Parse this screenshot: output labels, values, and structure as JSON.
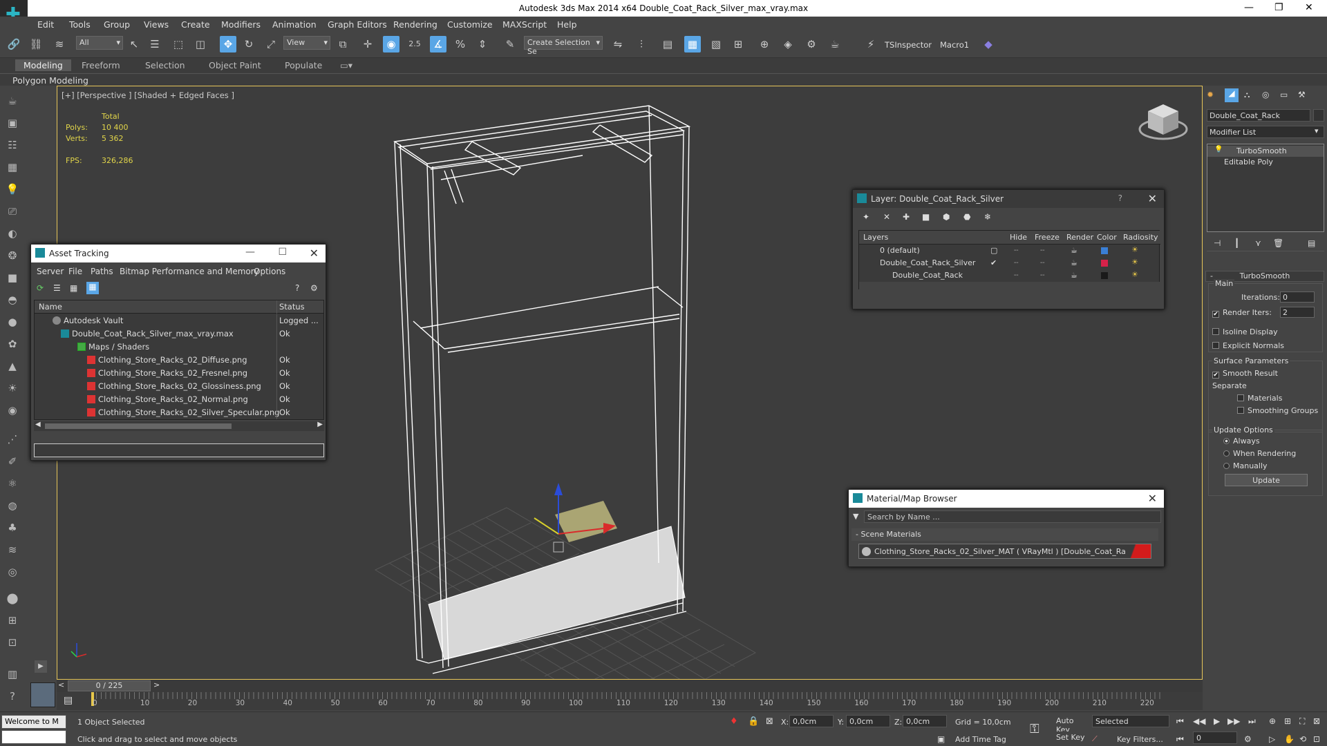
{
  "window": {
    "title": "Autodesk 3ds Max  2014 x64    Double_Coat_Rack_Silver_max_vray.max"
  },
  "menu": [
    "Edit",
    "Tools",
    "Group",
    "Views",
    "Create",
    "Modifiers",
    "Animation",
    "Graph Editors",
    "Rendering",
    "Customize",
    "MAXScript",
    "Help"
  ],
  "toolbar": {
    "filter_value": "All",
    "refcoord_value": "View",
    "snap_label": "2.5",
    "selection_set_placeholder": "Create Selection Se",
    "tsinspector_label": "TSInspector",
    "macro_label": "Macro1"
  },
  "ribbon": {
    "tabs": [
      "Modeling",
      "Freeform",
      "Selection",
      "Object Paint",
      "Populate"
    ],
    "active": "Modeling",
    "sub_label": "Polygon Modeling"
  },
  "viewport": {
    "label": "[+] [Perspective ] [Shaded + Edged Faces ]",
    "stats": {
      "total_label": "Total",
      "polys_label": "Polys:",
      "polys_value": "10 400",
      "verts_label": "Verts:",
      "verts_value": "5 362",
      "fps_label": "FPS:",
      "fps_value": "326,286"
    }
  },
  "asset_tracking": {
    "title": "Asset Tracking",
    "menu": [
      "Server",
      "File",
      "Paths",
      "Bitmap Performance and Memory",
      "Options"
    ],
    "col_name": "Name",
    "col_status": "Status",
    "rows": [
      {
        "name": "Autodesk Vault",
        "status": "Logged ..."
      },
      {
        "name": "Double_Coat_Rack_Silver_max_vray.max",
        "status": "Ok"
      },
      {
        "name": "Maps / Shaders",
        "status": ""
      },
      {
        "name": "Clothing_Store_Racks_02_Diffuse.png",
        "status": "Ok"
      },
      {
        "name": "Clothing_Store_Racks_02_Fresnel.png",
        "status": "Ok"
      },
      {
        "name": "Clothing_Store_Racks_02_Glossiness.png",
        "status": "Ok"
      },
      {
        "name": "Clothing_Store_Racks_02_Normal.png",
        "status": "Ok"
      },
      {
        "name": "Clothing_Store_Racks_02_Silver_Specular.png",
        "status": "Ok"
      }
    ]
  },
  "layer_dialog": {
    "title": "Layer: Double_Coat_Rack_Silver",
    "help": "?",
    "cols": [
      "Layers",
      "Hide",
      "Freeze",
      "Render",
      "Color",
      "Radiosity"
    ],
    "rows": [
      {
        "name": "0 (default)",
        "color": "#3a7fd6"
      },
      {
        "name": "Double_Coat_Rack_Silver",
        "color": "#d6224a"
      },
      {
        "name": "Double_Coat_Rack",
        "color": "#1a1a1a"
      }
    ]
  },
  "material_browser": {
    "title": "Material/Map Browser",
    "search_placeholder": "Search by Name ...",
    "section": "- Scene Materials",
    "item": "Clothing_Store_Racks_02_Silver_MAT  ( VRayMtl )  [Double_Coat_Rack]"
  },
  "command_panel": {
    "object_name": "Double_Coat_Rack",
    "modifier_list": "Modifier List",
    "stack": [
      "TurboSmooth",
      "Editable Poly"
    ],
    "rollout": "TurboSmooth",
    "main": "Main",
    "iterations_label": "Iterations:",
    "iterations_value": "0",
    "render_iters_label": "Render Iters:",
    "render_iters_value": "2",
    "isoline": "Isoline Display",
    "explicit": "Explicit Normals",
    "surface": "Surface Parameters",
    "smooth": "Smooth Result",
    "separate": "Separate",
    "materials": "Materials",
    "smoothing": "Smoothing Groups",
    "update_options": "Update Options",
    "always": "Always",
    "when_rendering": "When Rendering",
    "manually": "Manually",
    "update_btn": "Update"
  },
  "timeline": {
    "frame_label": "0 / 225",
    "ticks": [
      "0",
      "10",
      "20",
      "30",
      "40",
      "50",
      "60",
      "70",
      "80",
      "90",
      "100",
      "110",
      "120",
      "130",
      "140",
      "150",
      "160",
      "170",
      "180",
      "190",
      "200",
      "210",
      "220"
    ]
  },
  "status": {
    "maxscript": "Welcome to M",
    "selected": "1 Object Selected",
    "hint": "Click and drag to select and move objects",
    "x_label": "X:",
    "x_value": "0,0cm",
    "y_label": "Y:",
    "y_value": "0,0cm",
    "z_label": "Z:",
    "z_value": "0,0cm",
    "grid": "Grid = 10,0cm",
    "add_time_tag": "Add Time Tag",
    "auto_key": "Auto Key",
    "set_key": "Set Key",
    "selected_dd": "Selected",
    "key_filters": "Key Filters...",
    "frame_value": "0"
  }
}
